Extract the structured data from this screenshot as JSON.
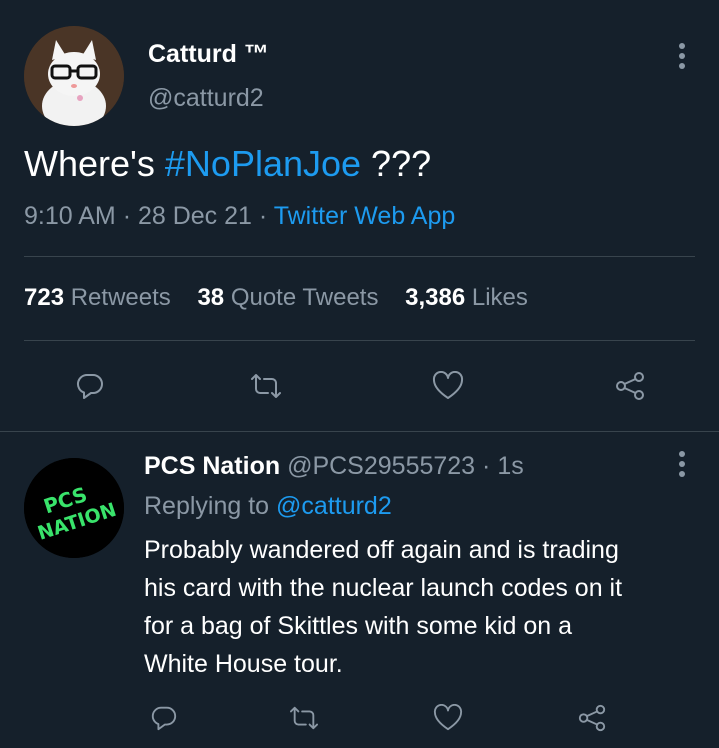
{
  "tweet": {
    "author_name": "Catturd ™",
    "author_handle": "@catturd2",
    "text_before": "Where's ",
    "hashtag": "#NoPlanJoe",
    "text_after": " ???",
    "time": "9:10 AM",
    "date": "28 Dec 21",
    "source": "Twitter Web App",
    "sep": "·"
  },
  "stats": {
    "retweets_count": "723",
    "retweets_label": "Retweets",
    "quotes_count": "38",
    "quotes_label": "Quote Tweets",
    "likes_count": "3,386",
    "likes_label": "Likes"
  },
  "reply": {
    "author_name": "PCS Nation",
    "author_handle": "@PCS29555723",
    "time": "1s",
    "replying_prefix": "Replying to",
    "replying_to": "@catturd2",
    "lines": [
      "Probably wandered off again and is trading",
      "his card with the nuclear launch codes on it",
      "for a bag of Skittles with some kid on a",
      "White House tour."
    ],
    "avatar_text_1": "PCS",
    "avatar_text_2": "NATION"
  },
  "icons": [
    "more-icon",
    "reply-icon",
    "retweet-icon",
    "like-icon",
    "share-icon"
  ],
  "colors": {
    "background": "#15202b",
    "accent": "#1d9bf0",
    "secondary": "#8b98a5",
    "divider": "#38444d"
  }
}
